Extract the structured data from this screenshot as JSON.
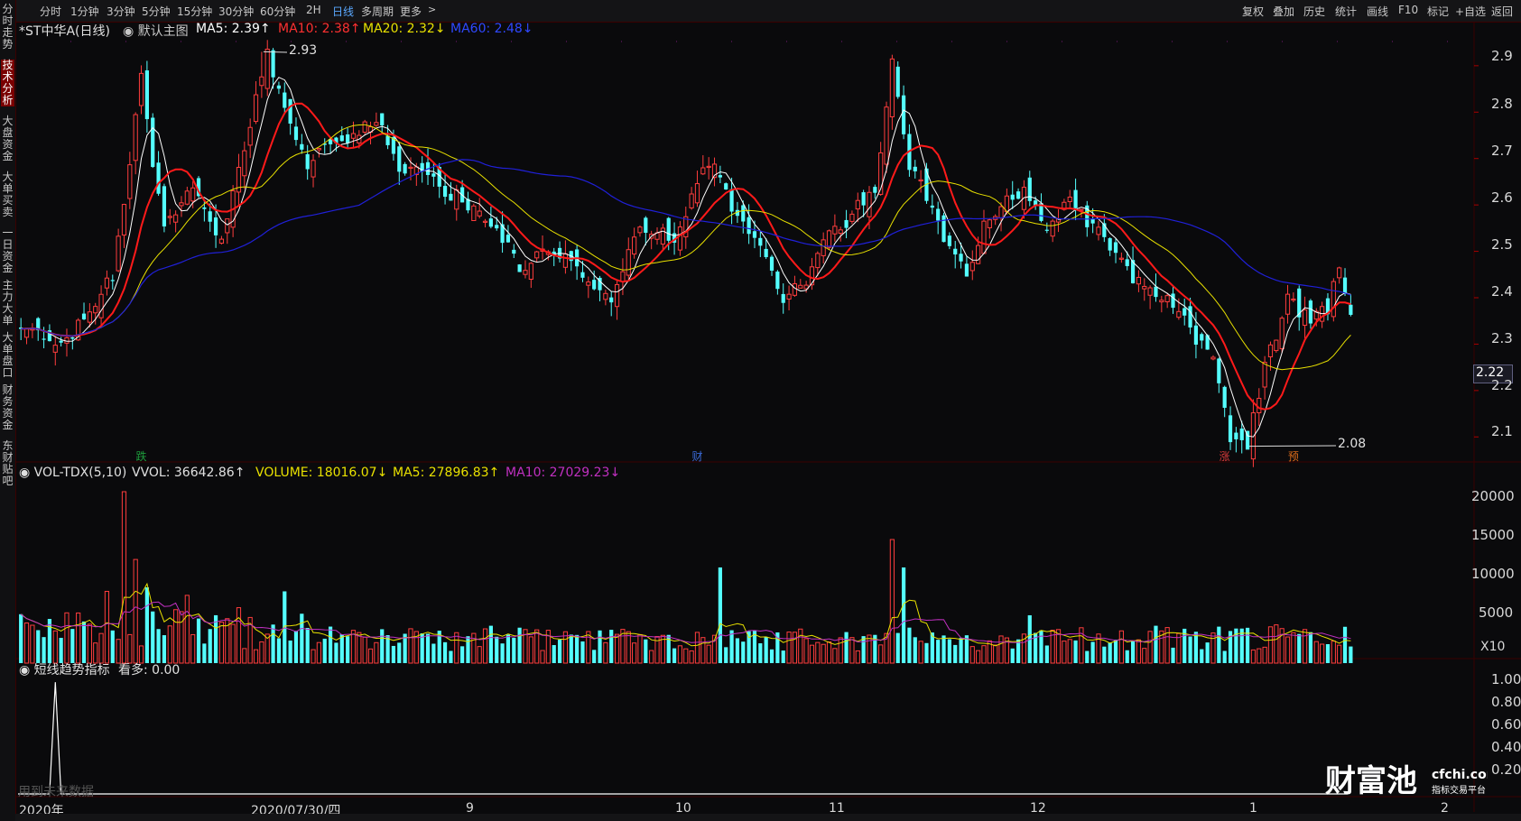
{
  "toolbar": {
    "left_items": [
      "分时",
      "1分钟",
      "3分钟",
      "5分钟",
      "15分钟",
      "30分钟",
      "60分钟",
      "2H",
      "日线",
      "多周期",
      "更多"
    ],
    "active": "日线",
    "right_items": [
      "复权",
      "叠加",
      "历史",
      "统计",
      "画线",
      "F10",
      "标记",
      "+自选",
      "返回"
    ]
  },
  "sidebar": {
    "tabs": [
      "分时走势",
      "技术分析",
      "大盘资金",
      "大单买卖",
      "一日资金",
      "主力大单",
      "大单盘口",
      "财务资金",
      "东财贴吧"
    ],
    "active": "技术分析"
  },
  "main_header": {
    "stock": "*ST中华A(日线)",
    "template": "默认主图",
    "ma5": "MA5: 2.39↑",
    "ma10": "MA10: 2.38↑",
    "ma20": "MA20: 2.32↓",
    "ma60": "MA60: 2.48↓"
  },
  "vol_header": {
    "name": "VOL-TDX(5,10)",
    "vvol": "VVOL: 36642.86↑",
    "volume": "VOLUME: 18016.07↓",
    "ma5": "MA5: 27896.83↑",
    "ma10": "MA10: 27029.23↓"
  },
  "ind_header": {
    "name": "短线趋势指标",
    "value": "看多: 0.00"
  },
  "annotations": {
    "high": "2.93",
    "low": "2.08",
    "current_price": "2.22",
    "future_data": "用到未来数据",
    "vol_unit": "X10"
  },
  "markers": [
    {
      "text": "跌",
      "index": 21,
      "color": "#1e9c3c"
    },
    {
      "text": "财",
      "index": 118,
      "color": "#3a6ad8"
    },
    {
      "text": "涨",
      "index": 210,
      "color": "#d83a3a"
    },
    {
      "text": "预",
      "index": 222,
      "color": "#d86a1a"
    }
  ],
  "x_labels": [
    "2020年",
    "2020/07/30/四",
    "9",
    "10",
    "11",
    "12",
    "1",
    "2"
  ],
  "colors": {
    "up": "#ff3d3d",
    "down": "#54ffff",
    "ma5": "#ffffff",
    "ma10": "#ff1a1a",
    "ma20": "#e8e000",
    "ma60": "#2020d8",
    "vol_ma5": "#e8e000",
    "vol_ma10": "#c030c0",
    "indicator": "#ffffff"
  },
  "chart_data": [
    {
      "type": "candlestick",
      "title": "*ST中华A(日线)",
      "y_axis_ticks": [
        2.1,
        2.2,
        2.3,
        2.4,
        2.5,
        2.6,
        2.7,
        2.8,
        2.9
      ],
      "ylim": [
        2.05,
        2.96
      ],
      "labeled_extremes": {
        "high": 2.93,
        "low": 2.08
      },
      "last_ma": {
        "MA5": 2.39,
        "MA10": 2.38,
        "MA20": 2.32,
        "MA60": 2.48
      },
      "knots": [
        [
          0,
          2.33
        ],
        [
          8,
          2.31
        ],
        [
          12,
          2.36
        ],
        [
          16,
          2.45
        ],
        [
          19,
          2.7
        ],
        [
          21,
          2.89
        ],
        [
          23,
          2.68
        ],
        [
          25,
          2.55
        ],
        [
          27,
          2.57
        ],
        [
          30,
          2.64
        ],
        [
          33,
          2.56
        ],
        [
          35,
          2.51
        ],
        [
          37,
          2.63
        ],
        [
          41,
          2.82
        ],
        [
          43,
          2.93
        ],
        [
          46,
          2.8
        ],
        [
          50,
          2.68
        ],
        [
          53,
          2.72
        ],
        [
          57,
          2.75
        ],
        [
          62,
          2.79
        ],
        [
          66,
          2.68
        ],
        [
          70,
          2.66
        ],
        [
          76,
          2.62
        ],
        [
          82,
          2.57
        ],
        [
          87,
          2.46
        ],
        [
          92,
          2.5
        ],
        [
          98,
          2.46
        ],
        [
          103,
          2.38
        ],
        [
          108,
          2.56
        ],
        [
          114,
          2.52
        ],
        [
          120,
          2.7
        ],
        [
          124,
          2.59
        ],
        [
          129,
          2.5
        ],
        [
          133,
          2.4
        ],
        [
          137,
          2.44
        ],
        [
          141,
          2.53
        ],
        [
          145,
          2.58
        ],
        [
          149,
          2.63
        ],
        [
          152,
          2.9
        ],
        [
          155,
          2.68
        ],
        [
          158,
          2.62
        ],
        [
          161,
          2.52
        ],
        [
          165,
          2.45
        ],
        [
          169,
          2.58
        ],
        [
          175,
          2.63
        ],
        [
          179,
          2.55
        ],
        [
          183,
          2.62
        ],
        [
          187,
          2.55
        ],
        [
          191,
          2.5
        ],
        [
          196,
          2.41
        ],
        [
          200,
          2.39
        ],
        [
          204,
          2.33
        ],
        [
          208,
          2.27
        ],
        [
          211,
          2.1
        ],
        [
          214,
          2.08
        ],
        [
          217,
          2.25
        ],
        [
          221,
          2.4
        ],
        [
          225,
          2.35
        ],
        [
          228,
          2.38
        ],
        [
          230,
          2.46
        ],
        [
          232,
          2.38
        ]
      ]
    },
    {
      "type": "bar",
      "title": "VOL-TDX(5,10)",
      "y_axis_ticks": [
        5000,
        10000,
        15000,
        20000
      ],
      "ylim": [
        0,
        21500
      ],
      "unit_label": "X10",
      "spikes": [
        [
          18,
          21500
        ],
        [
          20,
          13000
        ],
        [
          22,
          9500
        ],
        [
          29,
          8500
        ],
        [
          15,
          9000
        ],
        [
          46,
          9000
        ],
        [
          122,
          12000
        ],
        [
          152,
          15500
        ],
        [
          154,
          12000
        ],
        [
          176,
          6000
        ],
        [
          219,
          4800
        ]
      ]
    },
    {
      "type": "line",
      "title": "短线趋势指标",
      "y_axis_ticks": [
        0.2,
        0.4,
        0.6,
        0.8,
        1.0
      ],
      "ylim": [
        0,
        1.05
      ],
      "spike": {
        "x_index": 6,
        "value": 1.0
      },
      "current": 0.0
    }
  ]
}
